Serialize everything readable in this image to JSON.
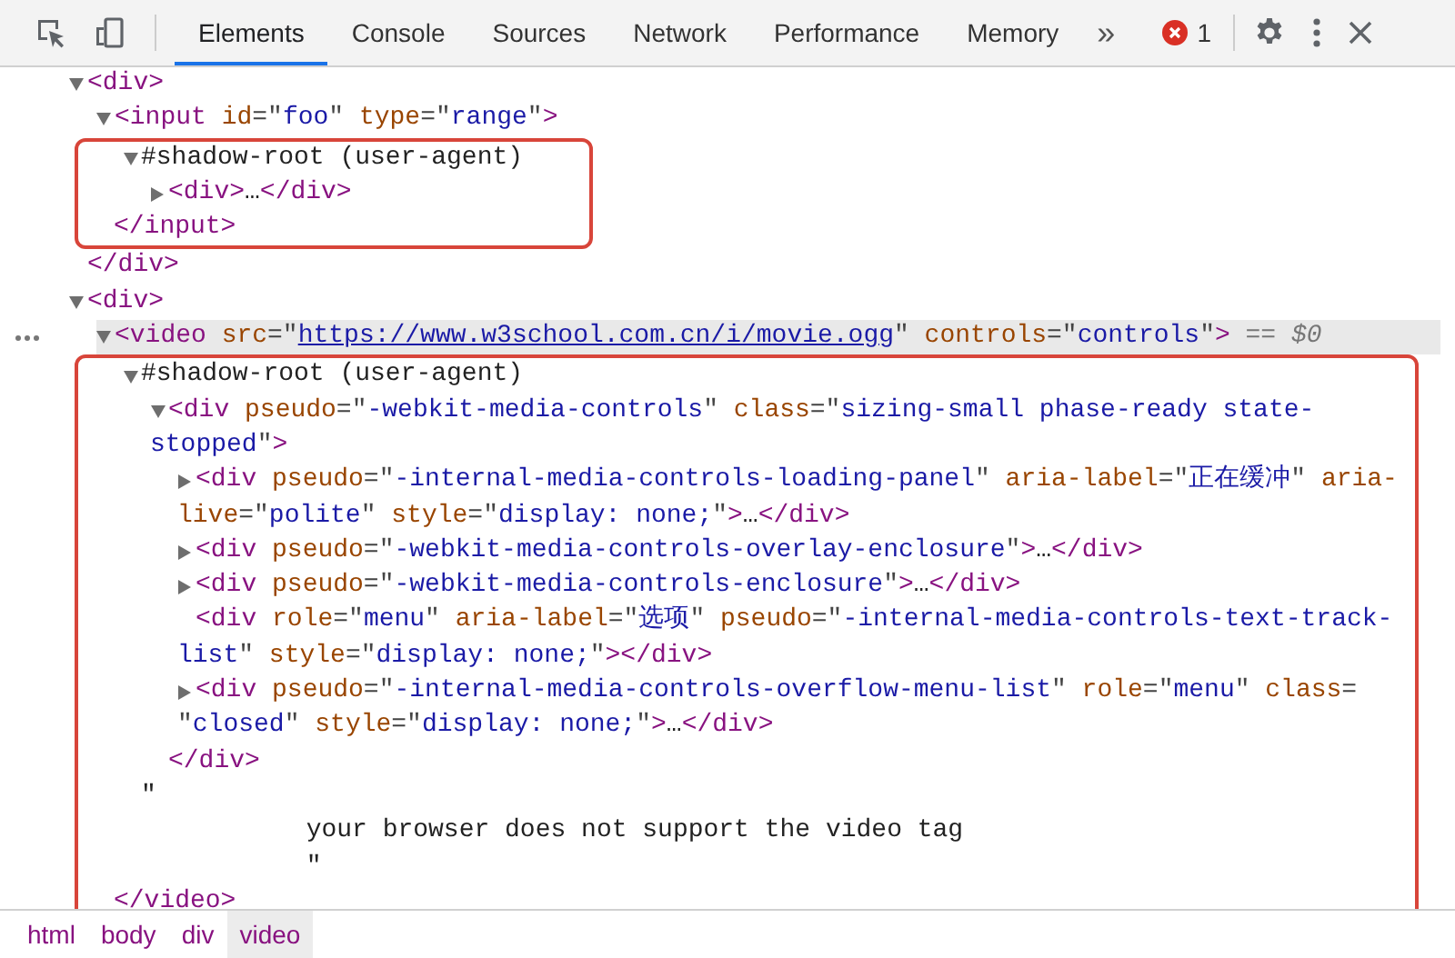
{
  "toolbar": {
    "tabs": [
      {
        "label": "Elements",
        "selected": true
      },
      {
        "label": "Console",
        "selected": false
      },
      {
        "label": "Sources",
        "selected": false
      },
      {
        "label": "Network",
        "selected": false
      },
      {
        "label": "Performance",
        "selected": false
      },
      {
        "label": "Memory",
        "selected": false
      }
    ],
    "overflow": "»",
    "error_count": "1"
  },
  "dom_tree": [
    {
      "expandable": true,
      "expanded": true,
      "selected": false,
      "annotated": false,
      "lines": [
        [
          {
            "kind": "tag",
            "text": "<div>"
          }
        ]
      ],
      "children": [
        {
          "expandable": true,
          "expanded": true,
          "selected": false,
          "annotated": true,
          "lines": [
            [
              {
                "kind": "tag",
                "text": "<input"
              },
              {
                "kind": "attr",
                "text": " id"
              },
              {
                "kind": "punct",
                "text": "=\""
              },
              {
                "kind": "value",
                "text": "foo"
              },
              {
                "kind": "punct",
                "text": "\""
              },
              {
                "kind": "attr",
                "text": " type"
              },
              {
                "kind": "punct",
                "text": "=\""
              },
              {
                "kind": "value",
                "text": "range"
              },
              {
                "kind": "punct",
                "text": "\""
              },
              {
                "kind": "tag",
                "text": ">"
              }
            ]
          ],
          "children": [
            {
              "expandable": true,
              "expanded": true,
              "selected": false,
              "annotated": false,
              "lines": [
                [
                  {
                    "kind": "text",
                    "text": "#shadow-root (user-agent)"
                  }
                ]
              ],
              "children": [
                {
                  "expandable": true,
                  "expanded": false,
                  "selected": false,
                  "annotated": false,
                  "lines": [
                    [
                      {
                        "kind": "tag",
                        "text": "<div>"
                      },
                      {
                        "kind": "text",
                        "text": "…"
                      },
                      {
                        "kind": "tag",
                        "text": "</div>"
                      }
                    ]
                  ]
                }
              ]
            }
          ],
          "close": [
            {
              "kind": "tag",
              "text": "</input>"
            }
          ]
        }
      ],
      "close": [
        {
          "kind": "tag",
          "text": "</div>"
        }
      ]
    },
    {
      "expandable": true,
      "expanded": true,
      "selected": false,
      "annotated": false,
      "lines": [
        [
          {
            "kind": "tag",
            "text": "<div>"
          }
        ]
      ],
      "children": [
        {
          "expandable": true,
          "expanded": true,
          "selected": true,
          "annotated": true,
          "lines": [
            [
              {
                "kind": "tag",
                "text": "<video"
              },
              {
                "kind": "attr",
                "text": " src"
              },
              {
                "kind": "punct",
                "text": "=\""
              },
              {
                "kind": "link",
                "text": "https://www.w3school.com.cn/i/movie.ogg"
              },
              {
                "kind": "punct",
                "text": "\""
              },
              {
                "kind": "attr",
                "text": " controls"
              },
              {
                "kind": "punct",
                "text": "=\""
              },
              {
                "kind": "value",
                "text": "controls"
              },
              {
                "kind": "punct",
                "text": "\""
              },
              {
                "kind": "tag",
                "text": ">"
              },
              {
                "kind": "marker",
                "text": " == $0"
              }
            ]
          ],
          "children": [
            {
              "expandable": true,
              "expanded": true,
              "selected": false,
              "annotated": false,
              "lines": [
                [
                  {
                    "kind": "text",
                    "text": "#shadow-root (user-agent)"
                  }
                ]
              ],
              "children": [
                {
                  "expandable": true,
                  "expanded": true,
                  "selected": false,
                  "annotated": false,
                  "lines": [
                    [
                      {
                        "kind": "tag",
                        "text": "<div"
                      },
                      {
                        "kind": "attr",
                        "text": " pseudo"
                      },
                      {
                        "kind": "punct",
                        "text": "=\""
                      },
                      {
                        "kind": "value",
                        "text": "-webkit-media-controls"
                      },
                      {
                        "kind": "punct",
                        "text": "\""
                      },
                      {
                        "kind": "attr",
                        "text": " class"
                      },
                      {
                        "kind": "punct",
                        "text": "=\""
                      },
                      {
                        "kind": "value",
                        "text": "sizing-small phase-ready state-"
                      }
                    ],
                    [
                      {
                        "kind": "value",
                        "text": "stopped"
                      },
                      {
                        "kind": "punct",
                        "text": "\""
                      },
                      {
                        "kind": "tag",
                        "text": ">"
                      }
                    ]
                  ],
                  "children": [
                    {
                      "expandable": true,
                      "expanded": false,
                      "selected": false,
                      "annotated": false,
                      "lines": [
                        [
                          {
                            "kind": "tag",
                            "text": "<div"
                          },
                          {
                            "kind": "attr",
                            "text": " pseudo"
                          },
                          {
                            "kind": "punct",
                            "text": "=\""
                          },
                          {
                            "kind": "value",
                            "text": "-internal-media-controls-loading-panel"
                          },
                          {
                            "kind": "punct",
                            "text": "\""
                          },
                          {
                            "kind": "attr",
                            "text": " aria-label"
                          },
                          {
                            "kind": "punct",
                            "text": "=\""
                          },
                          {
                            "kind": "value",
                            "text": "正在缓冲"
                          },
                          {
                            "kind": "punct",
                            "text": "\""
                          },
                          {
                            "kind": "attr",
                            "text": " aria-"
                          }
                        ],
                        [
                          {
                            "kind": "attr",
                            "text": "live"
                          },
                          {
                            "kind": "punct",
                            "text": "=\""
                          },
                          {
                            "kind": "value",
                            "text": "polite"
                          },
                          {
                            "kind": "punct",
                            "text": "\""
                          },
                          {
                            "kind": "attr",
                            "text": " style"
                          },
                          {
                            "kind": "punct",
                            "text": "=\""
                          },
                          {
                            "kind": "value",
                            "text": "display: none;"
                          },
                          {
                            "kind": "punct",
                            "text": "\""
                          },
                          {
                            "kind": "tag",
                            "text": ">"
                          },
                          {
                            "kind": "text",
                            "text": "…"
                          },
                          {
                            "kind": "tag",
                            "text": "</div>"
                          }
                        ]
                      ]
                    },
                    {
                      "expandable": true,
                      "expanded": false,
                      "selected": false,
                      "annotated": false,
                      "lines": [
                        [
                          {
                            "kind": "tag",
                            "text": "<div"
                          },
                          {
                            "kind": "attr",
                            "text": " pseudo"
                          },
                          {
                            "kind": "punct",
                            "text": "=\""
                          },
                          {
                            "kind": "value",
                            "text": "-webkit-media-controls-overlay-enclosure"
                          },
                          {
                            "kind": "punct",
                            "text": "\""
                          },
                          {
                            "kind": "tag",
                            "text": ">"
                          },
                          {
                            "kind": "text",
                            "text": "…"
                          },
                          {
                            "kind": "tag",
                            "text": "</div>"
                          }
                        ]
                      ]
                    },
                    {
                      "expandable": true,
                      "expanded": false,
                      "selected": false,
                      "annotated": false,
                      "lines": [
                        [
                          {
                            "kind": "tag",
                            "text": "<div"
                          },
                          {
                            "kind": "attr",
                            "text": " pseudo"
                          },
                          {
                            "kind": "punct",
                            "text": "=\""
                          },
                          {
                            "kind": "value",
                            "text": "-webkit-media-controls-enclosure"
                          },
                          {
                            "kind": "punct",
                            "text": "\""
                          },
                          {
                            "kind": "tag",
                            "text": ">"
                          },
                          {
                            "kind": "text",
                            "text": "…"
                          },
                          {
                            "kind": "tag",
                            "text": "</div>"
                          }
                        ]
                      ]
                    },
                    {
                      "expandable": false,
                      "selected": false,
                      "annotated": false,
                      "lines": [
                        [
                          {
                            "kind": "tag",
                            "text": "<div"
                          },
                          {
                            "kind": "attr",
                            "text": " role"
                          },
                          {
                            "kind": "punct",
                            "text": "=\""
                          },
                          {
                            "kind": "value",
                            "text": "menu"
                          },
                          {
                            "kind": "punct",
                            "text": "\""
                          },
                          {
                            "kind": "attr",
                            "text": " aria-label"
                          },
                          {
                            "kind": "punct",
                            "text": "=\""
                          },
                          {
                            "kind": "value",
                            "text": "选项"
                          },
                          {
                            "kind": "punct",
                            "text": "\""
                          },
                          {
                            "kind": "attr",
                            "text": " pseudo"
                          },
                          {
                            "kind": "punct",
                            "text": "=\""
                          },
                          {
                            "kind": "value",
                            "text": "-internal-media-controls-text-track-"
                          }
                        ],
                        [
                          {
                            "kind": "value",
                            "text": "list"
                          },
                          {
                            "kind": "punct",
                            "text": "\""
                          },
                          {
                            "kind": "attr",
                            "text": " style"
                          },
                          {
                            "kind": "punct",
                            "text": "=\""
                          },
                          {
                            "kind": "value",
                            "text": "display: none;"
                          },
                          {
                            "kind": "punct",
                            "text": "\""
                          },
                          {
                            "kind": "tag",
                            "text": "></div>"
                          }
                        ]
                      ]
                    },
                    {
                      "expandable": true,
                      "expanded": false,
                      "selected": false,
                      "annotated": false,
                      "lines": [
                        [
                          {
                            "kind": "tag",
                            "text": "<div"
                          },
                          {
                            "kind": "attr",
                            "text": " pseudo"
                          },
                          {
                            "kind": "punct",
                            "text": "=\""
                          },
                          {
                            "kind": "value",
                            "text": "-internal-media-controls-overflow-menu-list"
                          },
                          {
                            "kind": "punct",
                            "text": "\""
                          },
                          {
                            "kind": "attr",
                            "text": " role"
                          },
                          {
                            "kind": "punct",
                            "text": "=\""
                          },
                          {
                            "kind": "value",
                            "text": "menu"
                          },
                          {
                            "kind": "punct",
                            "text": "\""
                          },
                          {
                            "kind": "attr",
                            "text": " class"
                          },
                          {
                            "kind": "punct",
                            "text": "="
                          }
                        ],
                        [
                          {
                            "kind": "punct",
                            "text": "\""
                          },
                          {
                            "kind": "value",
                            "text": "closed"
                          },
                          {
                            "kind": "punct",
                            "text": "\""
                          },
                          {
                            "kind": "attr",
                            "text": " style"
                          },
                          {
                            "kind": "punct",
                            "text": "=\""
                          },
                          {
                            "kind": "value",
                            "text": "display: none;"
                          },
                          {
                            "kind": "punct",
                            "text": "\""
                          },
                          {
                            "kind": "tag",
                            "text": ">"
                          },
                          {
                            "kind": "text",
                            "text": "…"
                          },
                          {
                            "kind": "tag",
                            "text": "</div>"
                          }
                        ]
                      ]
                    }
                  ],
                  "close": [
                    {
                      "kind": "tag",
                      "text": "</div>"
                    }
                  ]
                }
              ]
            },
            {
              "expandable": false,
              "selected": false,
              "annotated": false,
              "lines": [
                [
                  {
                    "kind": "text",
                    "text": "\""
                  }
                ],
                [
                  {
                    "kind": "text",
                    "text": "            your browser does not support the video tag"
                  }
                ],
                [
                  {
                    "kind": "text",
                    "text": "            \""
                  }
                ]
              ]
            }
          ],
          "close": [
            {
              "kind": "tag",
              "text": "</video>"
            }
          ]
        }
      ]
    }
  ],
  "breadcrumbs": [
    {
      "label": "html",
      "selected": false
    },
    {
      "label": "body",
      "selected": false
    },
    {
      "label": "div",
      "selected": false
    },
    {
      "label": "video",
      "selected": true
    }
  ]
}
